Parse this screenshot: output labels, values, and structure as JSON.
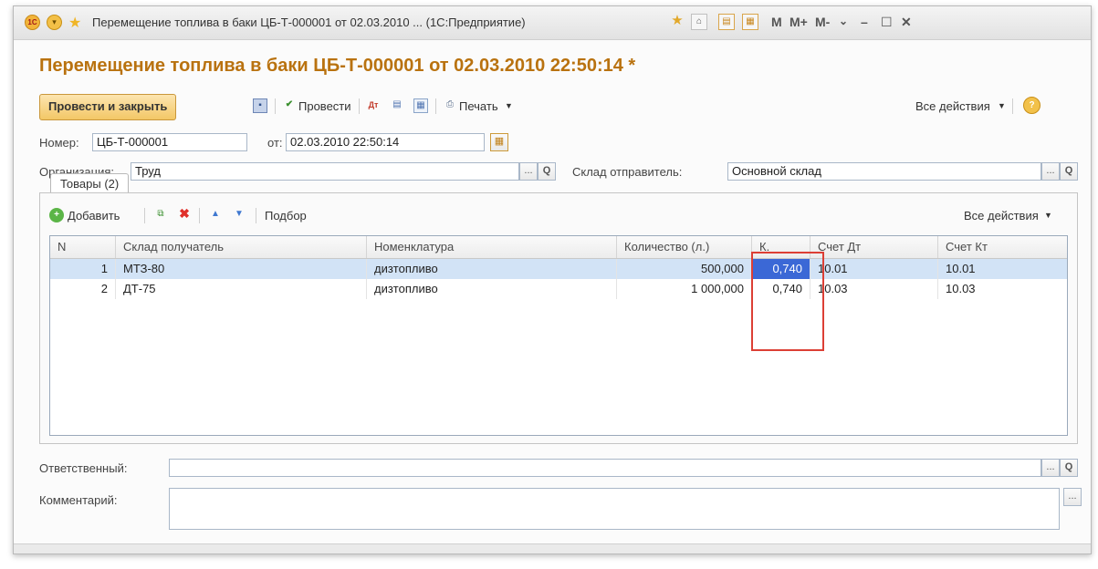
{
  "window": {
    "title": "Перемещение топлива в баки ЦБ-Т-000001 от 02.03.2010 ... (1С:Предприятие)",
    "logo_text": "1С",
    "memory_labels": [
      "M",
      "M+",
      "M-"
    ]
  },
  "header": {
    "title": "Перемещение топлива в баки ЦБ-Т-000001 от 02.03.2010 22:50:14 *"
  },
  "toolbar": {
    "post_close_label": "Провести и закрыть",
    "post_label": "Провести",
    "print_label": "Печать",
    "all_actions_label": "Все действия",
    "help_label": "?"
  },
  "fields": {
    "number_label": "Номер:",
    "number_value": "ЦБ-Т-000001",
    "date_label": "от:",
    "date_value": "02.03.2010 22:50:14",
    "org_label": "Организация:",
    "org_value": "Труд",
    "warehouse_label": "Склад отправитель:",
    "warehouse_value": "Основной склад",
    "responsible_label": "Ответственный:",
    "responsible_value": "",
    "comment_label": "Комментарий:",
    "comment_value": "",
    "picker_dots": "...",
    "picker_search": "Q"
  },
  "tabs": [
    {
      "label": "Товары (2)"
    }
  ],
  "goods_toolbar": {
    "add_label": "Добавить",
    "pick_label": "Подбор",
    "all_actions_label": "Все действия"
  },
  "grid": {
    "columns": [
      "N",
      "Склад получатель",
      "Номенклатура",
      "Количество (л.)",
      "К.",
      "Счет Дт",
      "Счет Кт"
    ],
    "rows": [
      {
        "n": "1",
        "warehouse": "МТЗ-80",
        "item": "дизтопливо",
        "qty": "500,000",
        "coef": "0,740",
        "debit": "10.01",
        "credit": "10.01"
      },
      {
        "n": "2",
        "warehouse": "ДТ-75",
        "item": "дизтопливо",
        "qty": "1 000,000",
        "coef": "0,740",
        "debit": "10.03",
        "credit": "10.03"
      }
    ]
  },
  "colors": {
    "title": "#b9720f",
    "primary_button": "#f3c766",
    "selected_row": "#d2e3f6",
    "current_cell": "#3b68d6",
    "highlight_frame": "#dc3f35"
  }
}
